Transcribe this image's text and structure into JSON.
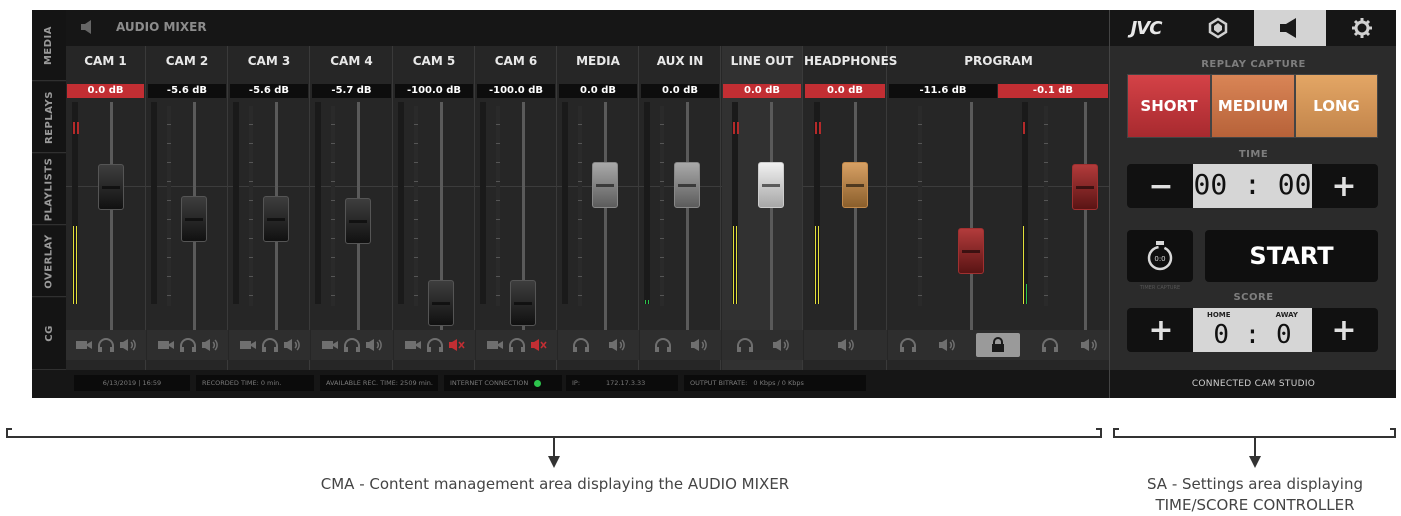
{
  "nav": {
    "tabs": [
      "MEDIA",
      "REPLAYS",
      "PLAYLISTS",
      "OVERLAY",
      "CG"
    ]
  },
  "header": {
    "title": "AUDIO MIXER"
  },
  "mixer": {
    "channels": [
      {
        "name": "CAM 1",
        "db": "0.0 dB",
        "db_highlight": true
      },
      {
        "name": "CAM 2",
        "db": "-5.6 dB",
        "db_highlight": false
      },
      {
        "name": "CAM 3",
        "db": "-5.6 dB",
        "db_highlight": false
      },
      {
        "name": "CAM 4",
        "db": "-5.7 dB",
        "db_highlight": false
      },
      {
        "name": "CAM 5",
        "db": "-100.0 dB",
        "db_highlight": false,
        "muted": true
      },
      {
        "name": "CAM 6",
        "db": "-100.0 dB",
        "db_highlight": false,
        "muted": true
      },
      {
        "name": "MEDIA",
        "db": "0.0 dB",
        "db_highlight": false
      },
      {
        "name": "AUX IN",
        "db": "0.0 dB",
        "db_highlight": false
      },
      {
        "name": "LINE OUT",
        "db": "0.0 dB",
        "db_highlight": true
      },
      {
        "name": "HEADPHONES",
        "db": "0.0 dB",
        "db_highlight": true
      }
    ],
    "program": {
      "name": "PROGRAM",
      "db_left": "-11.6 dB",
      "db_right": "-0.1 dB"
    }
  },
  "status": {
    "date": "6/13/2019 | 16:59",
    "recorded_label": "RECORDED TIME: 0 min.",
    "available_label": "AVAILABLE REC. TIME: 2509 min.",
    "internet_label": "INTERNET CONNECTION",
    "ip_label": "IP:",
    "ip_value": "172.17.3.33",
    "bitrate_label": "OUTPUT BITRATE:",
    "bitrate_value": "0 Kbps / 0 Kbps"
  },
  "settings": {
    "brand": "JVC",
    "replay_capture_title": "REPLAY CAPTURE",
    "replay_buttons": [
      {
        "label": "SHORT",
        "color": "#c6373d"
      },
      {
        "label": "MEDIUM",
        "color": "#cf7a4a"
      },
      {
        "label": "LONG",
        "color": "#dc9a59"
      }
    ],
    "time_title": "TIME",
    "time_value": "00 : 00",
    "minus": "−",
    "plus": "+",
    "start_label": "START",
    "timer_caption": "TIMER CAPTURE",
    "score_title": "SCORE",
    "home_label": "HOME",
    "away_label": "AWAY",
    "score_value": "0 : 0",
    "footer": "CONNECTED CAM STUDIO"
  },
  "annotations": {
    "cma": "CMA - Content management area displaying the AUDIO MIXER",
    "sa_line1": "SA - Settings area displaying",
    "sa_line2": "TIME/SCORE CONTROLLER"
  },
  "colors": {
    "accent_red": "#c22e33",
    "gold": "#c38a4c",
    "meter_green": "#2cc44c",
    "meter_yellow": "#e3e03a"
  }
}
